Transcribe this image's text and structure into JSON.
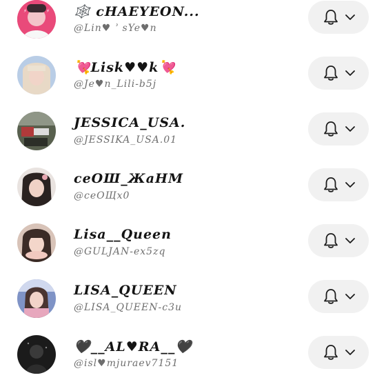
{
  "accounts": [
    {
      "name": "🕸️ cHAEYEON...",
      "handle": "@Lin♥ ʾ sYe♥n",
      "avatar_color": "#e94a7a"
    },
    {
      "name": "💘Lisk♥♥k💘",
      "handle": "@Je♥n_Lili-b5j",
      "avatar_color": "#b9cde6"
    },
    {
      "name": "JESSICA_USA.",
      "handle": "@JESSIKA_USA.01",
      "avatar_color": "#58604e"
    },
    {
      "name": "сеОШ_ЖаНМ",
      "handle": "@сеОЩх0",
      "avatar_color": "#6a5d5a"
    },
    {
      "name": "Lisa__Queen",
      "handle": "@GULJAN-ex5zq",
      "avatar_color": "#c9a99a"
    },
    {
      "name": "LISA_QUEEN",
      "handle": "@LISA_QUEEN-c3u",
      "avatar_color": "#7f93c6"
    },
    {
      "name": "🖤__AL♥RA__🖤",
      "handle": "@isl♥mjuraev7151",
      "avatar_color": "#1b1b1b"
    }
  ],
  "icons": {
    "bell": "bell-icon",
    "chevron": "chevron-down-icon"
  },
  "colors": {
    "button_bg": "#f1f1f1",
    "name_text": "#141414",
    "handle_text": "#6e6e6e"
  }
}
